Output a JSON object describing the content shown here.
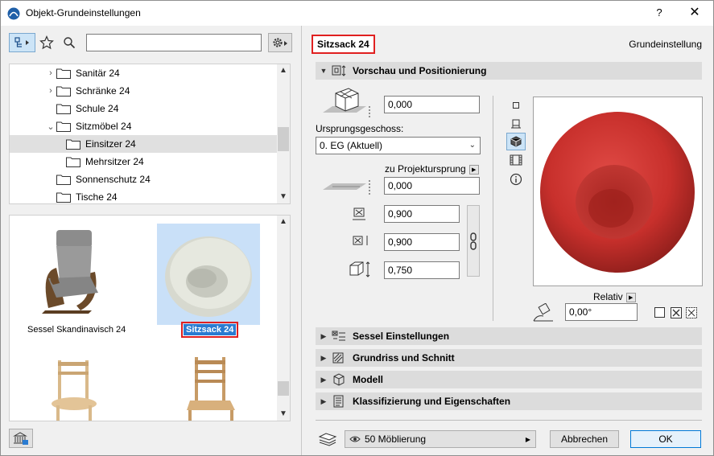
{
  "window": {
    "title": "Objekt-Grundeinstellungen",
    "help": "?",
    "close": "✕"
  },
  "tree": {
    "items": [
      {
        "label": "Sanitär 24",
        "chevron": "›"
      },
      {
        "label": "Schränke 24",
        "chevron": "›"
      },
      {
        "label": "Schule 24",
        "chevron": ""
      },
      {
        "label": "Sitzmöbel 24",
        "chevron": "⌄"
      },
      {
        "label": "Einsitzer 24",
        "chevron": ""
      },
      {
        "label": "Mehrsitzer 24",
        "chevron": ""
      },
      {
        "label": "Sonnenschutz 24",
        "chevron": ""
      },
      {
        "label": "Tische 24",
        "chevron": ""
      }
    ]
  },
  "gallery": {
    "items": [
      {
        "label": "Sessel Skandinavisch 24"
      },
      {
        "label": "Sitzsack 24"
      }
    ]
  },
  "header": {
    "object_name": "Sitzsack 24",
    "default_label": "Grundeinstellung"
  },
  "sections": {
    "preview_positioning": "Vorschau und Positionierung",
    "chair_settings": "Sessel Einstellungen",
    "floorplan_section": "Grundriss und Schnitt",
    "model": "Modell",
    "classification": "Klassifizierung und Eigenschaften"
  },
  "positioning": {
    "elevation_story": "0,000",
    "origin_story_label": "Ursprungsgeschoss:",
    "origin_story_value": "0. EG (Aktuell)",
    "project_zero_label": "zu Projektursprung",
    "elevation_project": "0,000",
    "width": "0,900",
    "depth": "0,900",
    "height": "0,750",
    "relative_label": "Relativ",
    "rotation": "0,00°"
  },
  "footer": {
    "layer": "50 Möblierung",
    "cancel": "Abbrechen",
    "ok": "OK"
  },
  "colors": {
    "accent": "#0078d7",
    "highlight_outline": "#e02020",
    "selection": "#2a7bd1"
  }
}
